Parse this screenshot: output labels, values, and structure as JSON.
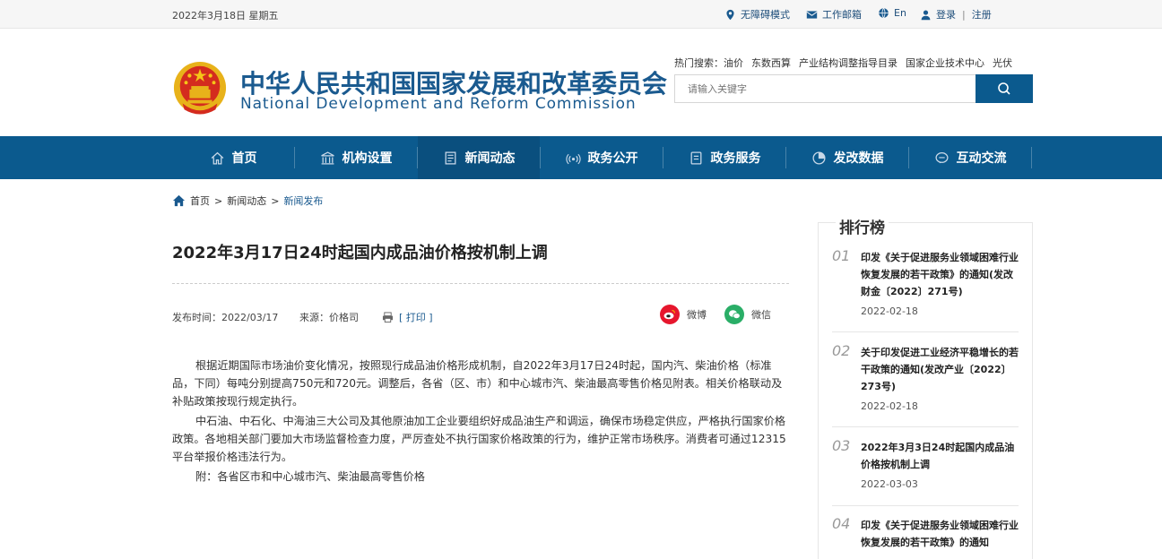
{
  "topbar": {
    "date": "2022年3月18日 星期五",
    "accessibility": "无障碍模式",
    "mailbox": "工作邮箱",
    "lang": "En",
    "login": "登录",
    "divider": "|",
    "register": "注册"
  },
  "header": {
    "title_cn": "中华人民共和国国家发展和改革委员会",
    "title_en": "National Development and Reform Commission",
    "hot_label": "热门搜索：",
    "hot_terms": [
      "油价",
      "东数西算",
      "产业结构调整指导目录",
      "国家企业技术中心",
      "光伏"
    ],
    "search_placeholder": "请输入关键字"
  },
  "nav": {
    "items": [
      {
        "label": "首页",
        "icon": "home-icon"
      },
      {
        "label": "机构设置",
        "icon": "building-icon"
      },
      {
        "label": "新闻动态",
        "icon": "news-icon",
        "active": true
      },
      {
        "label": "政务公开",
        "icon": "broadcast-icon"
      },
      {
        "label": "政务服务",
        "icon": "document-icon"
      },
      {
        "label": "发改数据",
        "icon": "pie-chart-icon"
      },
      {
        "label": "互动交流",
        "icon": "chat-icon"
      }
    ]
  },
  "breadcrumb": {
    "home": "首页",
    "sep": ">",
    "level1": "新闻动态",
    "level2": "新闻发布"
  },
  "article": {
    "title": "2022年3月17日24时起国内成品油价格按机制上调",
    "publish_time": "发布时间：2022/03/17",
    "source": "来源：价格司",
    "print": "[ 打印 ]",
    "share_weibo": "微博",
    "share_wechat": "微信",
    "paragraphs": [
      "根据近期国际市场油价变化情况，按照现行成品油价格形成机制，自2022年3月17日24时起，国内汽、柴油价格（标准品，下同）每吨分别提高750元和720元。调整后，各省（区、市）和中心城市汽、柴油最高零售价格见附表。相关价格联动及补贴政策按现行规定执行。",
      "中石油、中石化、中海油三大公司及其他原油加工企业要组织好成品油生产和调运，确保市场稳定供应，严格执行国家价格政策。各地相关部门要加大市场监督检查力度，严厉查处不执行国家价格政策的行为，维护正常市场秩序。消费者可通过12315平台举报价格违法行为。",
      "附：各省区市和中心城市汽、柴油最高零售价格"
    ]
  },
  "sidebar": {
    "title": "排行榜",
    "items": [
      {
        "num": "01",
        "text": "印发《关于促进服务业领域困难行业恢复发展的若干政策》的通知(发改财金〔2022〕271号)",
        "date": "2022-02-18"
      },
      {
        "num": "02",
        "text": "关于印发促进工业经济平稳增长的若干政策的通知(发改产业〔2022〕273号)",
        "date": "2022-02-18"
      },
      {
        "num": "03",
        "text": "2022年3月3日24时起国内成品油价格按机制上调",
        "date": "2022-03-03"
      },
      {
        "num": "04",
        "text": "印发《关于促进服务业领域困难行业恢复发展的若干政策》的通知",
        "date": ""
      }
    ]
  },
  "colors": {
    "brand": "#0b5a8e",
    "title": "#1a5a8f"
  }
}
